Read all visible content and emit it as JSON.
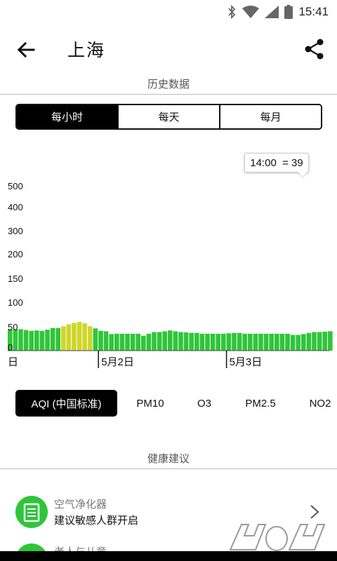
{
  "status_bar": {
    "time": "15:41",
    "icons": [
      "bluetooth-icon",
      "wifi-icon",
      "signal-icon",
      "battery-icon"
    ]
  },
  "app_bar": {
    "title": "上海",
    "back_icon": "arrow-left-icon",
    "share_icon": "share-icon"
  },
  "history": {
    "header": "历史数据",
    "tabs": [
      {
        "label": "每小时",
        "active": true
      },
      {
        "label": "每天",
        "active": false
      },
      {
        "label": "每月",
        "active": false
      }
    ]
  },
  "tooltip": {
    "text": "14:00  = 39"
  },
  "chart_data": {
    "type": "bar",
    "y_ticks": [
      {
        "label": "500",
        "value": 500
      },
      {
        "label": "400",
        "value": 400
      },
      {
        "label": "300",
        "value": 300
      },
      {
        "label": "200",
        "value": 200
      },
      {
        "label": "150",
        "value": 150
      },
      {
        "label": "100",
        "value": 100
      },
      {
        "label": "50",
        "value": 50
      },
      {
        "label": "0",
        "value": 0
      }
    ],
    "x_labels": [
      {
        "label": "日",
        "index": 0
      },
      {
        "label": "5月2日",
        "index": 17
      },
      {
        "label": "5月3日",
        "index": 41
      }
    ],
    "values": [
      44,
      44,
      44,
      42,
      40,
      41,
      40,
      43,
      47,
      47,
      51,
      55,
      58,
      60,
      57,
      51,
      46,
      40,
      39,
      32,
      33,
      33,
      33,
      33,
      33,
      28,
      33,
      37,
      37,
      39,
      41,
      39,
      37,
      36,
      35,
      35,
      33,
      33,
      33,
      33,
      33,
      34,
      35,
      35,
      33,
      33,
      33,
      33,
      33,
      33,
      33,
      33,
      33,
      30,
      30,
      32,
      35,
      37,
      37,
      38,
      39
    ],
    "colors": {
      "good": "#2fc53b",
      "moderate": "#cfd62b"
    },
    "moderate_threshold": 50,
    "ylim": [
      0,
      500
    ]
  },
  "pollutants": {
    "tabs": [
      {
        "label": "AQI (中国标准)",
        "active": true
      },
      {
        "label": "PM10",
        "active": false
      },
      {
        "label": "O3",
        "active": false
      },
      {
        "label": "PM2.5",
        "active": false
      },
      {
        "label": "NO2",
        "active": false
      }
    ]
  },
  "health": {
    "header": "健康建议",
    "items": [
      {
        "title": "空气净化器",
        "desc": "建议敏感人群开启",
        "icon": "air-purifier-icon"
      },
      {
        "title": "老人与儿童",
        "desc": "",
        "icon": "elderly-children-icon"
      }
    ]
  },
  "colors": {
    "accent": "#2fc53b",
    "active_tab": "#000000"
  }
}
